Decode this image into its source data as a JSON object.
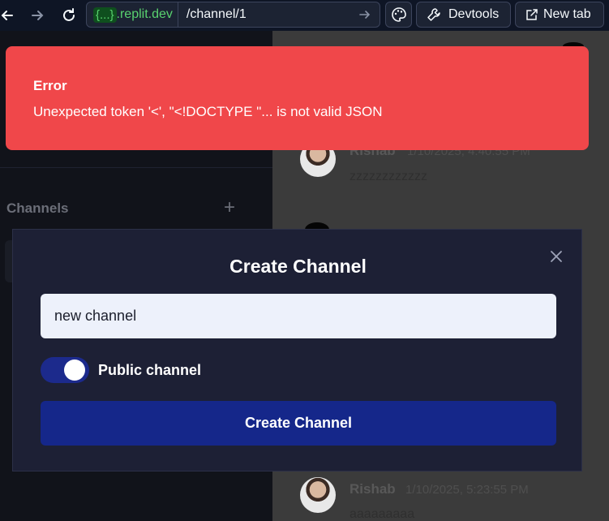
{
  "browser": {
    "url_token": "{...}",
    "url_domain": ".replit.dev",
    "url_path": "/channel/1",
    "devtools_label": "Devtools",
    "new_tab_label": "New tab"
  },
  "sidebar": {
    "channels_heading": "Channels",
    "add_channel_glyph": "+"
  },
  "chat": {
    "messages": [
      {
        "author": "Rishab",
        "time": "1/10/2025, 4:40:55 PM",
        "text": "zzzzzzzzzzzz"
      },
      {
        "author": "Rishab",
        "time": "1/10/2025, 5:23:55 PM",
        "text": "aaaaaaaaa"
      }
    ]
  },
  "toast": {
    "title": "Error",
    "message": "Unexpected token '<', \"<!DOCTYPE \"... is not valid JSON"
  },
  "modal": {
    "title": "Create Channel",
    "input_value": "new channel",
    "public_label": "Public channel",
    "public_enabled": true,
    "submit_label": "Create Channel"
  },
  "colors": {
    "error": "#f0474a",
    "accent": "#15278a",
    "modal_bg": "#1d2035"
  }
}
